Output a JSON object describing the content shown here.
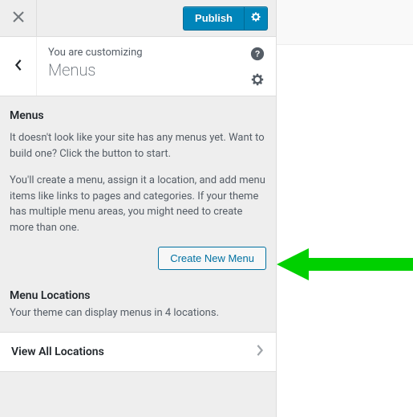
{
  "topbar": {
    "publish_label": "Publish"
  },
  "header": {
    "customizing_label": "You are customizing",
    "section_title": "Menus"
  },
  "menus": {
    "heading": "Menus",
    "p1": "It doesn't look like your site has any menus yet. Want to build one? Click the button to start.",
    "p2": "You'll create a menu, assign it a location, and add menu items like links to pages and categories. If your theme has multiple menu areas, you might need to create more than one.",
    "create_button_label": "Create New Menu"
  },
  "locations": {
    "heading": "Menu Locations",
    "description": "Your theme can display menus in 4 locations.",
    "view_all_label": "View All Locations"
  }
}
